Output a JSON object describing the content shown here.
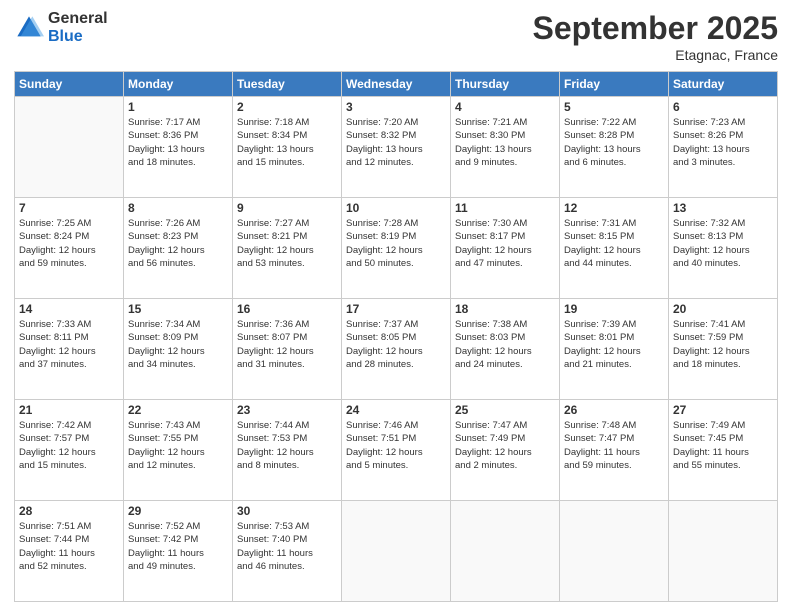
{
  "logo": {
    "general": "General",
    "blue": "Blue"
  },
  "header": {
    "month": "September 2025",
    "location": "Etagnac, France"
  },
  "days_of_week": [
    "Sunday",
    "Monday",
    "Tuesday",
    "Wednesday",
    "Thursday",
    "Friday",
    "Saturday"
  ],
  "weeks": [
    [
      {
        "day": "",
        "info": ""
      },
      {
        "day": "1",
        "info": "Sunrise: 7:17 AM\nSunset: 8:36 PM\nDaylight: 13 hours\nand 18 minutes."
      },
      {
        "day": "2",
        "info": "Sunrise: 7:18 AM\nSunset: 8:34 PM\nDaylight: 13 hours\nand 15 minutes."
      },
      {
        "day": "3",
        "info": "Sunrise: 7:20 AM\nSunset: 8:32 PM\nDaylight: 13 hours\nand 12 minutes."
      },
      {
        "day": "4",
        "info": "Sunrise: 7:21 AM\nSunset: 8:30 PM\nDaylight: 13 hours\nand 9 minutes."
      },
      {
        "day": "5",
        "info": "Sunrise: 7:22 AM\nSunset: 8:28 PM\nDaylight: 13 hours\nand 6 minutes."
      },
      {
        "day": "6",
        "info": "Sunrise: 7:23 AM\nSunset: 8:26 PM\nDaylight: 13 hours\nand 3 minutes."
      }
    ],
    [
      {
        "day": "7",
        "info": "Sunrise: 7:25 AM\nSunset: 8:24 PM\nDaylight: 12 hours\nand 59 minutes."
      },
      {
        "day": "8",
        "info": "Sunrise: 7:26 AM\nSunset: 8:23 PM\nDaylight: 12 hours\nand 56 minutes."
      },
      {
        "day": "9",
        "info": "Sunrise: 7:27 AM\nSunset: 8:21 PM\nDaylight: 12 hours\nand 53 minutes."
      },
      {
        "day": "10",
        "info": "Sunrise: 7:28 AM\nSunset: 8:19 PM\nDaylight: 12 hours\nand 50 minutes."
      },
      {
        "day": "11",
        "info": "Sunrise: 7:30 AM\nSunset: 8:17 PM\nDaylight: 12 hours\nand 47 minutes."
      },
      {
        "day": "12",
        "info": "Sunrise: 7:31 AM\nSunset: 8:15 PM\nDaylight: 12 hours\nand 44 minutes."
      },
      {
        "day": "13",
        "info": "Sunrise: 7:32 AM\nSunset: 8:13 PM\nDaylight: 12 hours\nand 40 minutes."
      }
    ],
    [
      {
        "day": "14",
        "info": "Sunrise: 7:33 AM\nSunset: 8:11 PM\nDaylight: 12 hours\nand 37 minutes."
      },
      {
        "day": "15",
        "info": "Sunrise: 7:34 AM\nSunset: 8:09 PM\nDaylight: 12 hours\nand 34 minutes."
      },
      {
        "day": "16",
        "info": "Sunrise: 7:36 AM\nSunset: 8:07 PM\nDaylight: 12 hours\nand 31 minutes."
      },
      {
        "day": "17",
        "info": "Sunrise: 7:37 AM\nSunset: 8:05 PM\nDaylight: 12 hours\nand 28 minutes."
      },
      {
        "day": "18",
        "info": "Sunrise: 7:38 AM\nSunset: 8:03 PM\nDaylight: 12 hours\nand 24 minutes."
      },
      {
        "day": "19",
        "info": "Sunrise: 7:39 AM\nSunset: 8:01 PM\nDaylight: 12 hours\nand 21 minutes."
      },
      {
        "day": "20",
        "info": "Sunrise: 7:41 AM\nSunset: 7:59 PM\nDaylight: 12 hours\nand 18 minutes."
      }
    ],
    [
      {
        "day": "21",
        "info": "Sunrise: 7:42 AM\nSunset: 7:57 PM\nDaylight: 12 hours\nand 15 minutes."
      },
      {
        "day": "22",
        "info": "Sunrise: 7:43 AM\nSunset: 7:55 PM\nDaylight: 12 hours\nand 12 minutes."
      },
      {
        "day": "23",
        "info": "Sunrise: 7:44 AM\nSunset: 7:53 PM\nDaylight: 12 hours\nand 8 minutes."
      },
      {
        "day": "24",
        "info": "Sunrise: 7:46 AM\nSunset: 7:51 PM\nDaylight: 12 hours\nand 5 minutes."
      },
      {
        "day": "25",
        "info": "Sunrise: 7:47 AM\nSunset: 7:49 PM\nDaylight: 12 hours\nand 2 minutes."
      },
      {
        "day": "26",
        "info": "Sunrise: 7:48 AM\nSunset: 7:47 PM\nDaylight: 11 hours\nand 59 minutes."
      },
      {
        "day": "27",
        "info": "Sunrise: 7:49 AM\nSunset: 7:45 PM\nDaylight: 11 hours\nand 55 minutes."
      }
    ],
    [
      {
        "day": "28",
        "info": "Sunrise: 7:51 AM\nSunset: 7:44 PM\nDaylight: 11 hours\nand 52 minutes."
      },
      {
        "day": "29",
        "info": "Sunrise: 7:52 AM\nSunset: 7:42 PM\nDaylight: 11 hours\nand 49 minutes."
      },
      {
        "day": "30",
        "info": "Sunrise: 7:53 AM\nSunset: 7:40 PM\nDaylight: 11 hours\nand 46 minutes."
      },
      {
        "day": "",
        "info": ""
      },
      {
        "day": "",
        "info": ""
      },
      {
        "day": "",
        "info": ""
      },
      {
        "day": "",
        "info": ""
      }
    ]
  ]
}
